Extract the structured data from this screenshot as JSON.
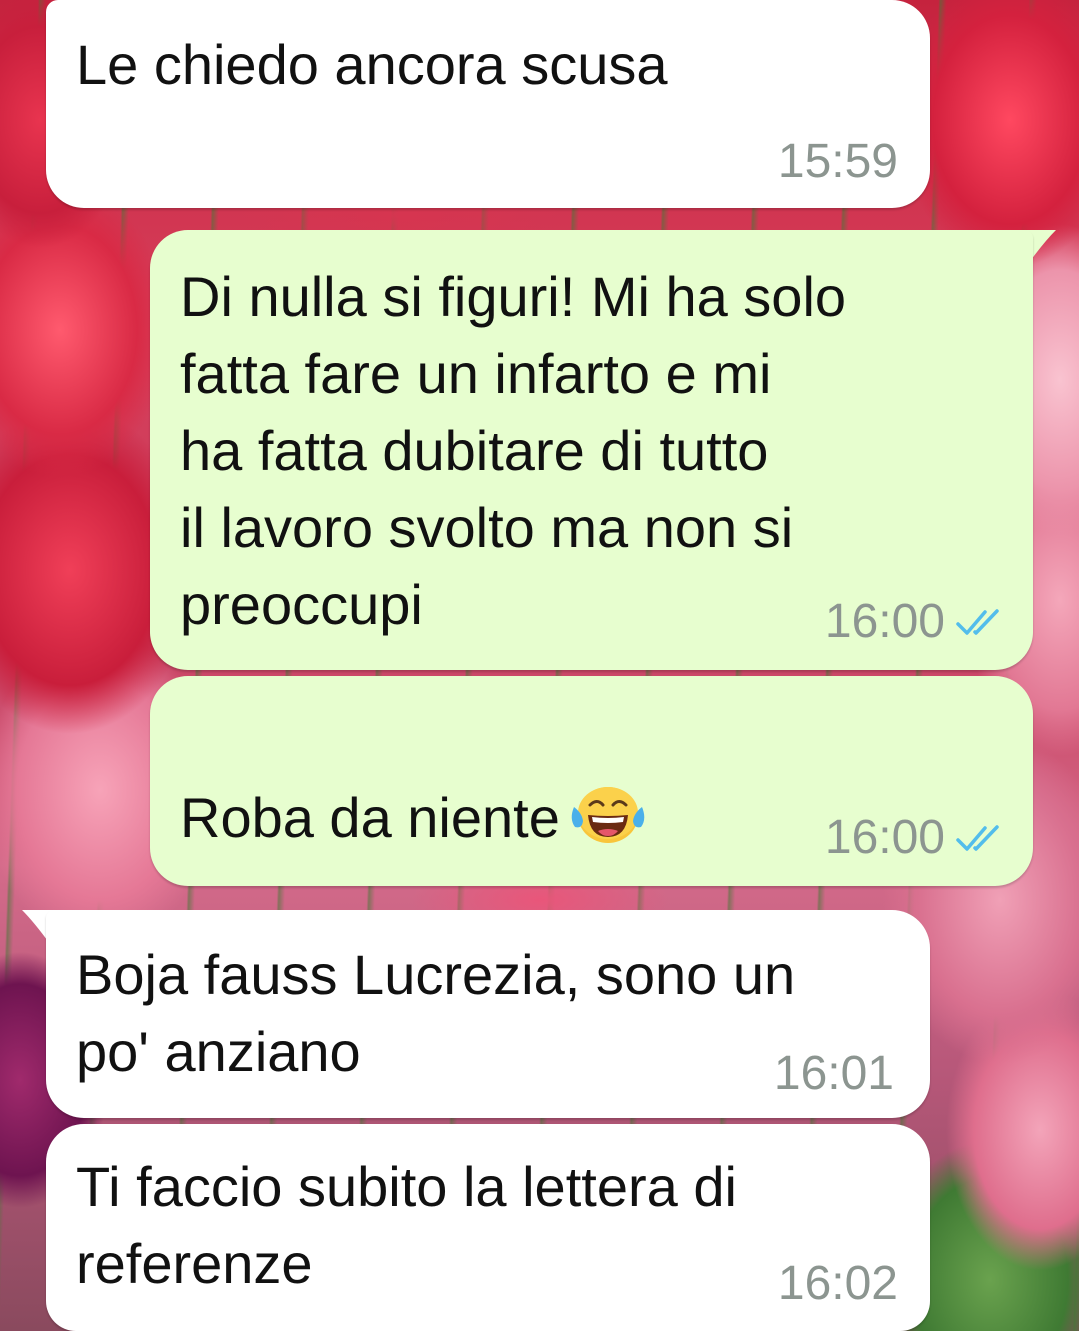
{
  "chat": {
    "messages": [
      {
        "direction": "incoming",
        "text": "Le chiedo ancora scusa",
        "time": "15:59"
      },
      {
        "direction": "outgoing",
        "text": "Di nulla si figuri! Mi ha solo\nfatta fare un infarto e mi\nha fatta dubitare di tutto\nil lavoro svolto ma non si\npreoccupi",
        "time": "16:00",
        "status_icon": "double-check-read-icon"
      },
      {
        "direction": "outgoing",
        "text": "Roba da niente",
        "emoji": "face-with-tears-of-joy",
        "time": "16:00",
        "status_icon": "double-check-read-icon"
      },
      {
        "direction": "incoming",
        "text": "Boja fauss Lucrezia, sono un\npo' anziano",
        "time": "16:01"
      },
      {
        "direction": "incoming",
        "text": "Ti faccio subito la lettera di\nreferenze",
        "time": "16:02"
      }
    ]
  },
  "colors": {
    "incoming_bubble": "#ffffff",
    "outgoing_bubble": "#e7fecf",
    "timestamp": "#8c9590",
    "read_ticks": "#53bdeb",
    "wallpaper_main": "#d8405c"
  }
}
